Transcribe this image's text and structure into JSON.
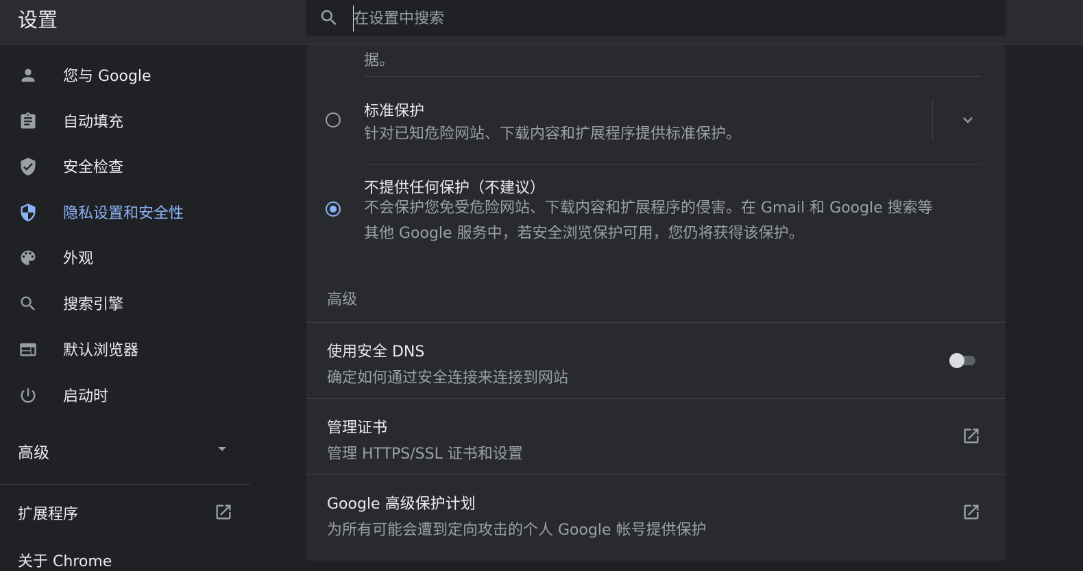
{
  "header": {
    "title": "设置",
    "search_placeholder": "在设置中搜索"
  },
  "sidebar": {
    "items": [
      {
        "label": "您与 Google",
        "icon": "person-icon"
      },
      {
        "label": "自动填充",
        "icon": "clipboard-icon"
      },
      {
        "label": "安全检查",
        "icon": "shield-check-icon"
      },
      {
        "label": "隐私设置和安全性",
        "icon": "shield-half-icon",
        "active": true
      },
      {
        "label": "外观",
        "icon": "palette-icon"
      },
      {
        "label": "搜索引擎",
        "icon": "search-icon"
      },
      {
        "label": "默认浏览器",
        "icon": "browser-icon"
      },
      {
        "label": "启动时",
        "icon": "power-icon"
      }
    ],
    "advanced_label": "高级",
    "extensions_label": "扩展程序",
    "about_label": "关于 Chrome"
  },
  "main": {
    "previous_option_tail": "据。",
    "options": [
      {
        "title": "标准保护",
        "description": "针对已知危险网站、下载内容和扩展程序提供标准保护。",
        "checked": false
      },
      {
        "title": "不提供任何保护（不建议）",
        "description_line1": "不会保护您免受危险网站、下载内容和扩展程序的侵害。在 Gmail 和 Google 搜索等",
        "description_line2": "其他 Google 服务中，若安全浏览保护可用，您仍将获得该保护。",
        "checked": true
      }
    ],
    "advanced_section_label": "高级",
    "settings": [
      {
        "title": "使用安全 DNS",
        "description": "确定如何通过安全连接来连接到网站",
        "control": "toggle",
        "enabled": false
      },
      {
        "title": "管理证书",
        "description": "管理 HTTPS/SSL 证书和设置",
        "control": "external-link"
      },
      {
        "title": "Google 高级保护计划",
        "description": "为所有可能会遭到定向攻击的个人 Google 帐号提供保护",
        "control": "external-link"
      }
    ]
  },
  "colors": {
    "background": "#202124",
    "card": "#292a2d",
    "accent": "#8ab4f8",
    "text_primary": "#e8eaed",
    "text_secondary": "#9aa0a6"
  }
}
